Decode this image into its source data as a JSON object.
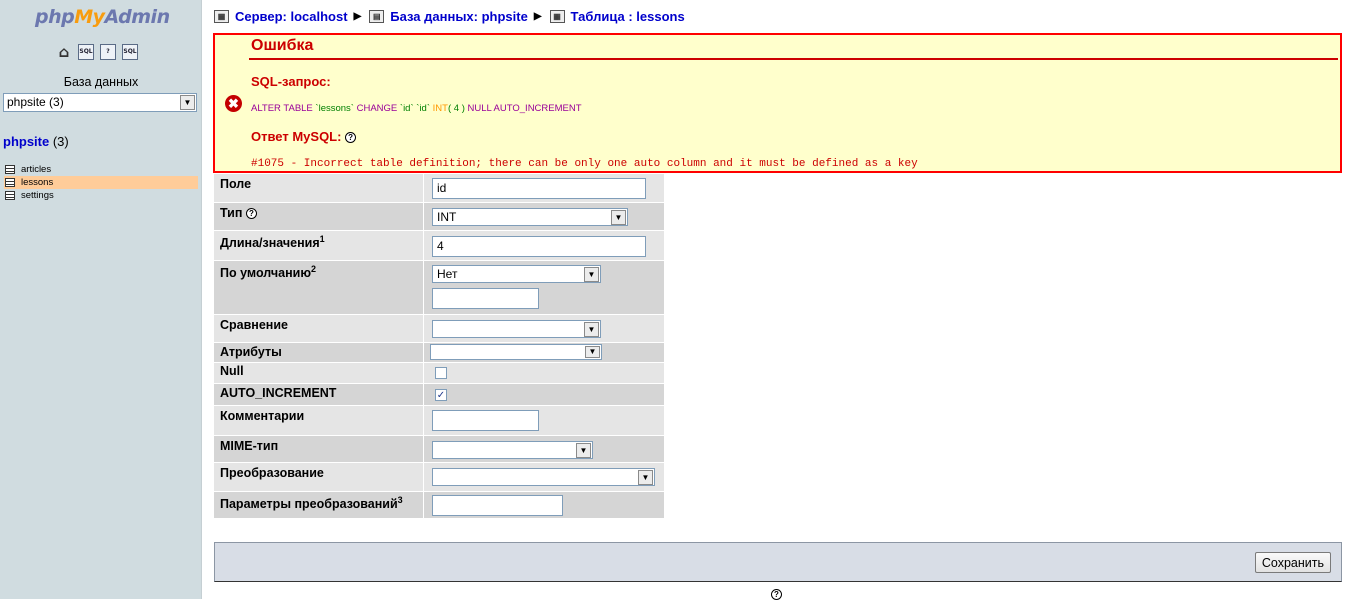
{
  "sidebar": {
    "logo": {
      "php": "php",
      "my": "My",
      "admin": "Admin"
    },
    "icons": [
      "home-icon",
      "sql-icon",
      "query-icon",
      "docs-icon"
    ],
    "icon_labels": {
      "sql": "SQL",
      "query": "?",
      "docs": "SQL"
    },
    "db_label": "База данных",
    "db_select_value": "phpsite (3)",
    "db_title_name": "phpsite",
    "db_title_count": " (3)",
    "tables": [
      {
        "name": "articles"
      },
      {
        "name": "lessons",
        "active": true
      },
      {
        "name": "settings"
      }
    ]
  },
  "breadcrumb": {
    "server": "Сервер: localhost",
    "database": "База данных: phpsite",
    "table": "Таблица : lessons"
  },
  "error": {
    "title": "Ошибка",
    "sql_label": "SQL-запрос:",
    "sql_query": {
      "alter": "ALTER TABLE ",
      "table": "`lessons`",
      "change": " CHANGE ",
      "col1": "`id`",
      "col2": "`id`",
      "type": "INT",
      "len": "( 4 )",
      "rest": " NULL AUTO_INCREMENT"
    },
    "mysql_label": "Ответ MySQL:",
    "mysql_message": "#1075 - Incorrect table definition; there can be only one auto column and it must be defined as a key"
  },
  "form": {
    "field_label": "Поле",
    "field_value": "id",
    "type_label": "Тип",
    "type_value": "INT",
    "length_label": "Длина/значения",
    "length_sup": "1",
    "length_value": "4",
    "default_label": "По умолчанию",
    "default_sup": "2",
    "default_value": "Нет",
    "default_text": "",
    "collation_label": "Сравнение",
    "collation_value": "",
    "attributes_label": "Атрибуты",
    "attributes_value": "",
    "null_label": "Null",
    "null_checked": false,
    "ai_label": "AUTO_INCREMENT",
    "ai_checked": true,
    "comment_label": "Комментарии",
    "comment_value": "",
    "mime_label": "MIME-тип",
    "mime_value": "",
    "transform_label": "Преобразование",
    "transform_value": "",
    "transform_opts_label": "Параметры преобразований",
    "transform_opts_sup": "3",
    "transform_opts_value": ""
  },
  "footer": {
    "save_label": "Сохранить"
  },
  "colors": {
    "error_border": "#ff0000",
    "error_bg": "#ffffcc",
    "selected_row": "#ffcc99",
    "link": "#0000cc"
  }
}
